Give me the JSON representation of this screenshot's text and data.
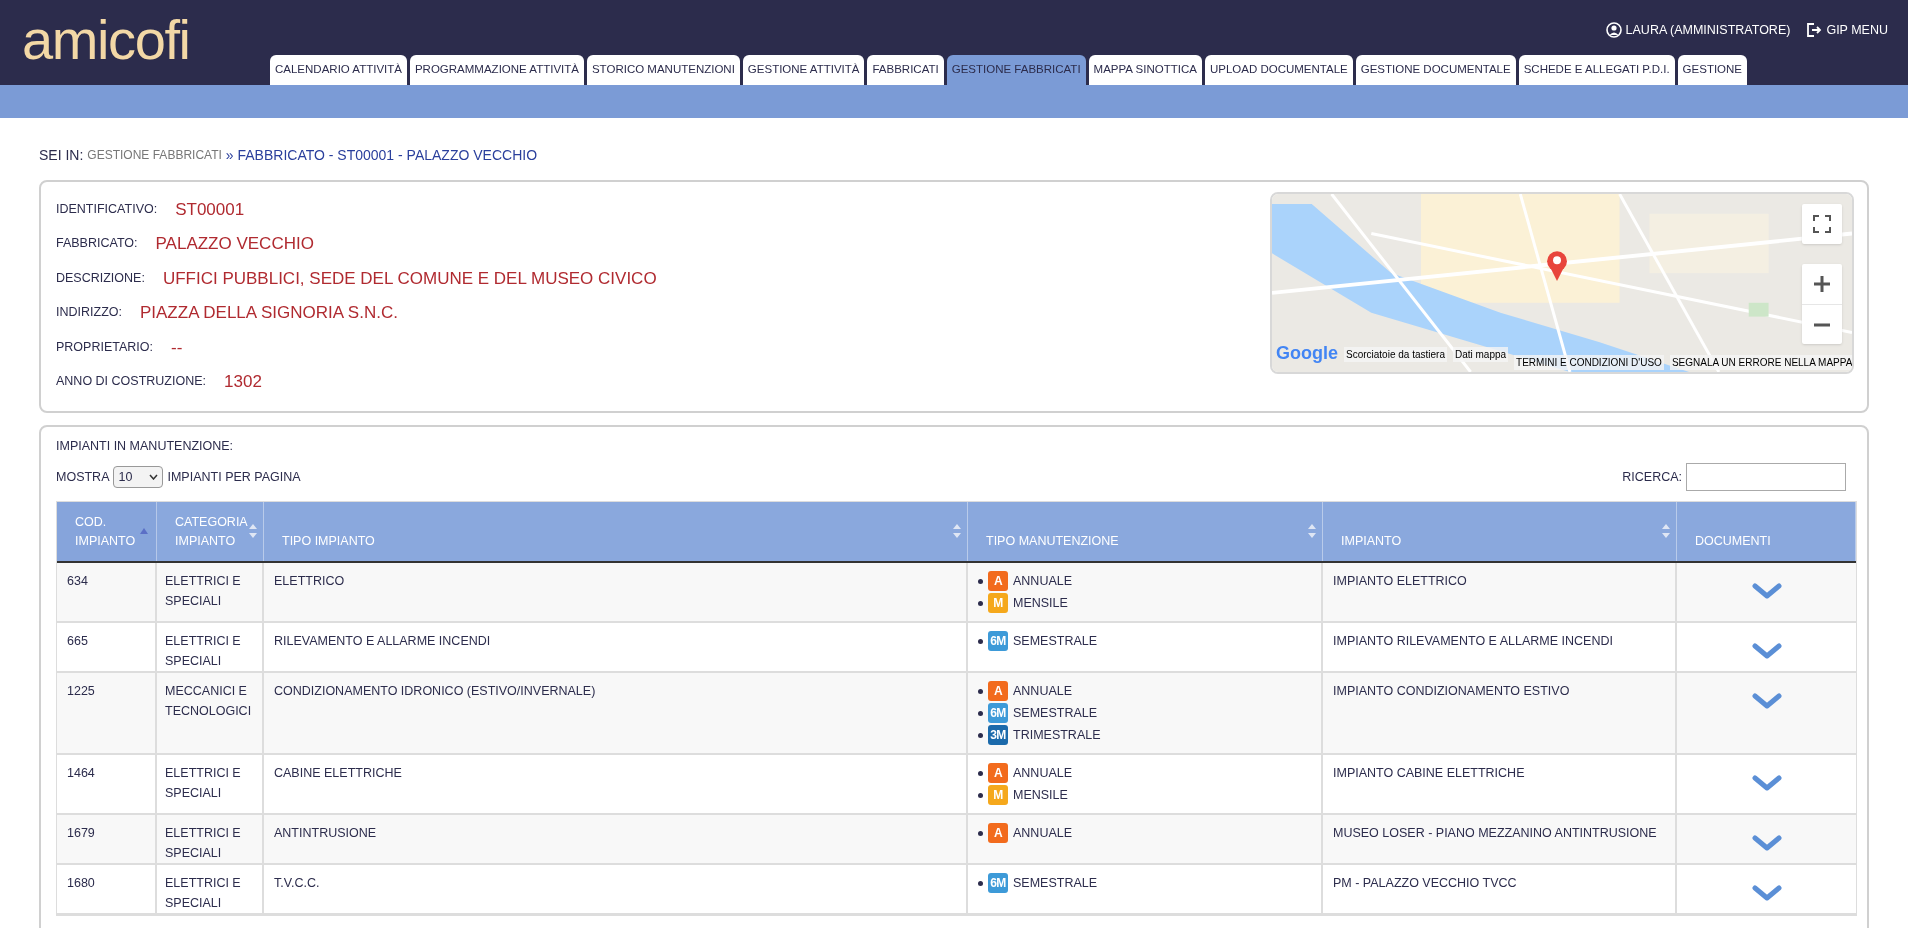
{
  "logo": "amicofi",
  "user": {
    "name": "LAURA (AMMINISTRATORE)",
    "menu": "GIP MENU"
  },
  "tabs": [
    {
      "label": "CALENDARIO ATTIVITÀ",
      "selected": false
    },
    {
      "label": "PROGRAMMAZIONE ATTIVITÀ",
      "selected": false
    },
    {
      "label": "STORICO MANUTENZIONI",
      "selected": false
    },
    {
      "label": "GESTIONE ATTIVITÀ",
      "selected": false
    },
    {
      "label": "FABBRICATI",
      "selected": false
    },
    {
      "label": "GESTIONE FABBRICATI",
      "selected": true
    },
    {
      "label": "MAPPA SINOTTICA",
      "selected": false
    },
    {
      "label": "UPLOAD DOCUMENTALE",
      "selected": false
    },
    {
      "label": "GESTIONE DOCUMENTALE",
      "selected": false
    },
    {
      "label": "SCHEDE E ALLEGATI P.D.I.",
      "selected": false
    },
    {
      "label": "GESTIONE",
      "selected": false
    }
  ],
  "breadcrumb": {
    "prefix": "SEI IN:",
    "parent": "GESTIONE FABBRICATI",
    "current": "» FABBRICATO - ST00001 - PALAZZO VECCHIO"
  },
  "details": [
    {
      "label": "IDENTIFICATIVO:",
      "value": "ST00001"
    },
    {
      "label": "FABBRICATO:",
      "value": "PALAZZO VECCHIO"
    },
    {
      "label": "DESCRIZIONE:",
      "value": "UFFICI PUBBLICI, SEDE DEL COMUNE E DEL MUSEO CIVICO"
    },
    {
      "label": "INDIRIZZO:",
      "value": "PIAZZA DELLA SIGNORIA S.N.C."
    },
    {
      "label": "PROPRIETARIO:",
      "value": "--"
    },
    {
      "label": "ANNO DI COSTRUZIONE:",
      "value": "1302"
    }
  ],
  "map": {
    "logo": "Google",
    "links": [
      "Scorciatoie da tastiera",
      "Dati mappa",
      "TERMINI E CONDIZIONI D'USO",
      "SEGNALA UN ERRORE NELLA MAPPA"
    ]
  },
  "table_section": {
    "title": "IMPIANTI IN MANUTENZIONE:",
    "show_label": "MOSTRA",
    "page_size": "10",
    "per_page_label": "IMPIANTI PER PAGINA",
    "search_label": "RICERCA:"
  },
  "table": {
    "columns": [
      {
        "label": "COD. IMPIANTO",
        "sortable": true,
        "sorted": true
      },
      {
        "label": "CATEGORIA IMPIANTO",
        "sortable": true,
        "sorted": false
      },
      {
        "label": "TIPO IMPIANTO",
        "sortable": true,
        "sorted": false
      },
      {
        "label": "TIPO MANUTENZIONE",
        "sortable": true,
        "sorted": false
      },
      {
        "label": "IMPIANTO",
        "sortable": true,
        "sorted": false
      },
      {
        "label": "DOCUMENTI",
        "sortable": false
      }
    ],
    "rows": [
      {
        "code": "634",
        "category": "ELETTRICI E SPECIALI",
        "type": "ELETTRICO",
        "maintenance": [
          {
            "badge": "A",
            "color": "#f26b1d",
            "label": "ANNUALE"
          },
          {
            "badge": "M",
            "color": "#f5a81c",
            "label": "MENSILE"
          }
        ],
        "plant": "IMPIANTO ELETTRICO"
      },
      {
        "code": "665",
        "category": "ELETTRICI E SPECIALI",
        "type": "RILEVAMENTO E ALLARME INCENDI",
        "maintenance": [
          {
            "badge": "6M",
            "color": "#3d9ad8",
            "label": "SEMESTRALE"
          }
        ],
        "plant": "IMPIANTO RILEVAMENTO E ALLARME INCENDI"
      },
      {
        "code": "1225",
        "category": "MECCANICI E TECNOLOGICI",
        "type": "CONDIZIONAMENTO IDRONICO (ESTIVO/INVERNALE)",
        "maintenance": [
          {
            "badge": "A",
            "color": "#f26b1d",
            "label": "ANNUALE"
          },
          {
            "badge": "6M",
            "color": "#3d9ad8",
            "label": "SEMESTRALE"
          },
          {
            "badge": "3M",
            "color": "#1b6aab",
            "label": "TRIMESTRALE"
          }
        ],
        "plant": "IMPIANTO CONDIZIONAMENTO ESTIVO"
      },
      {
        "code": "1464",
        "category": "ELETTRICI E SPECIALI",
        "type": "CABINE ELETTRICHE",
        "maintenance": [
          {
            "badge": "A",
            "color": "#f26b1d",
            "label": "ANNUALE"
          },
          {
            "badge": "M",
            "color": "#f5a81c",
            "label": "MENSILE"
          }
        ],
        "plant": "IMPIANTO CABINE ELETTRICHE"
      },
      {
        "code": "1679",
        "category": "ELETTRICI E SPECIALI",
        "type": "ANTINTRUSIONE",
        "maintenance": [
          {
            "badge": "A",
            "color": "#f26b1d",
            "label": "ANNUALE"
          }
        ],
        "plant": "MUSEO LOSER - PIANO MEZZANINO ANTINTRUSIONE"
      },
      {
        "code": "1680",
        "category": "ELETTRICI E SPECIALI",
        "type": "T.V.C.C.",
        "maintenance": [
          {
            "badge": "6M",
            "color": "#3d9ad8",
            "label": "SEMESTRALE"
          }
        ],
        "plant": "PM - PALAZZO VECCHIO TVCC"
      }
    ]
  }
}
